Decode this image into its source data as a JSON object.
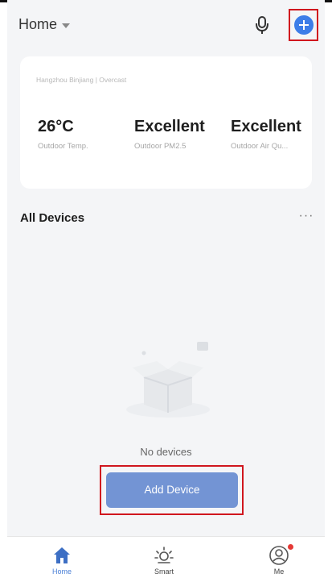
{
  "colors": {
    "accent": "#3d7de8",
    "add_device_button": "#7394d4",
    "highlight_box": "#d0161e",
    "badge": "#e53935",
    "active_tab": "#4a7fd6"
  },
  "header": {
    "home_label": "Home",
    "icons": [
      "chevron-down-icon",
      "microphone-icon",
      "plus-icon"
    ]
  },
  "weather": {
    "location": "Hangzhou Binjiang | Overcast",
    "stats": [
      {
        "value": "26°C",
        "label": "Outdoor Temp."
      },
      {
        "value": "Excellent",
        "label": "Outdoor PM2.5"
      },
      {
        "value": "Excellent",
        "label": "Outdoor Air Qu..."
      }
    ]
  },
  "devices": {
    "title": "All Devices",
    "more_label": "···",
    "empty_text": "No devices",
    "add_button_label": "Add Device"
  },
  "nav": {
    "items": [
      {
        "label": "Home",
        "icon": "home-icon",
        "active": true
      },
      {
        "label": "Smart",
        "icon": "sun-icon",
        "active": false
      },
      {
        "label": "Me",
        "icon": "profile-icon",
        "active": false
      }
    ]
  }
}
